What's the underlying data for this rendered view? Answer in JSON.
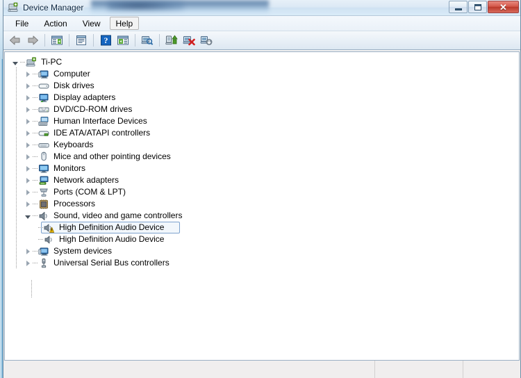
{
  "window": {
    "title": "Device Manager",
    "icon": "device-manager-icon",
    "buttons": {
      "minimize": "–",
      "maximize": "□",
      "close": "✕"
    }
  },
  "menubar": {
    "items": [
      {
        "label": "File",
        "active": false
      },
      {
        "label": "Action",
        "active": false
      },
      {
        "label": "View",
        "active": false
      },
      {
        "label": "Help",
        "active": true
      }
    ]
  },
  "toolbar": {
    "buttons": [
      {
        "name": "back-button",
        "icon": "back-arrow-icon"
      },
      {
        "name": "forward-button",
        "icon": "forward-arrow-icon"
      },
      {
        "name": "separator-1",
        "icon": "separator"
      },
      {
        "name": "show-hide-console-tree-button",
        "icon": "console-tree-icon"
      },
      {
        "name": "separator-2",
        "icon": "separator"
      },
      {
        "name": "properties-button",
        "icon": "properties-icon"
      },
      {
        "name": "separator-3",
        "icon": "separator"
      },
      {
        "name": "help-button",
        "icon": "help-question-icon"
      },
      {
        "name": "show-hide-action-pane-button",
        "icon": "action-pane-icon"
      },
      {
        "name": "separator-4",
        "icon": "separator"
      },
      {
        "name": "scan-for-hardware-changes-button",
        "icon": "scan-hardware-icon"
      },
      {
        "name": "separator-5",
        "icon": "separator"
      },
      {
        "name": "update-driver-button",
        "icon": "update-driver-icon"
      },
      {
        "name": "uninstall-device-button",
        "icon": "uninstall-device-icon"
      },
      {
        "name": "disable-device-button",
        "icon": "disable-device-icon"
      }
    ]
  },
  "tree": {
    "root": {
      "label": "Ti-PC",
      "icon": "computer-root-icon",
      "expanded": true
    },
    "items": [
      {
        "label": "Computer",
        "icon": "computer-icon",
        "expanded": false,
        "level": 1
      },
      {
        "label": "Disk drives",
        "icon": "disk-drive-icon",
        "expanded": false,
        "level": 1
      },
      {
        "label": "Display adapters",
        "icon": "display-adapter-icon",
        "expanded": false,
        "level": 1
      },
      {
        "label": "DVD/CD-ROM drives",
        "icon": "dvd-drive-icon",
        "expanded": false,
        "level": 1
      },
      {
        "label": "Human Interface Devices",
        "icon": "hid-icon",
        "expanded": false,
        "level": 1
      },
      {
        "label": "IDE ATA/ATAPI controllers",
        "icon": "ide-controller-icon",
        "expanded": false,
        "level": 1
      },
      {
        "label": "Keyboards",
        "icon": "keyboard-icon",
        "expanded": false,
        "level": 1
      },
      {
        "label": "Mice and other pointing devices",
        "icon": "mouse-icon",
        "expanded": false,
        "level": 1
      },
      {
        "label": "Monitors",
        "icon": "monitor-icon",
        "expanded": false,
        "level": 1
      },
      {
        "label": "Network adapters",
        "icon": "network-adapter-icon",
        "expanded": false,
        "level": 1
      },
      {
        "label": "Ports (COM & LPT)",
        "icon": "port-icon",
        "expanded": false,
        "level": 1
      },
      {
        "label": "Processors",
        "icon": "processor-icon",
        "expanded": false,
        "level": 1
      },
      {
        "label": "Sound, video and game controllers",
        "icon": "sound-controller-icon",
        "expanded": true,
        "level": 1
      },
      {
        "label": "High Definition Audio Device",
        "icon": "audio-device-warning-icon",
        "expanded": null,
        "level": 2,
        "selected": true,
        "warning": true
      },
      {
        "label": "High Definition Audio Device",
        "icon": "audio-device-icon",
        "expanded": null,
        "level": 2,
        "selected": false,
        "warning": false
      },
      {
        "label": "System devices",
        "icon": "system-device-icon",
        "expanded": false,
        "level": 1
      },
      {
        "label": "Universal Serial Bus controllers",
        "icon": "usb-controller-icon",
        "expanded": false,
        "level": 1
      }
    ]
  },
  "statusbar": {
    "panes": [
      "",
      "",
      ""
    ]
  },
  "colors": {
    "selection_border": "#7da2ce",
    "selection_fill": "#f2f7fc",
    "warning_yellow": "#ffcc00",
    "close_button_red": "#bb3a2c",
    "titlebar_blue": "#cfe2f2"
  }
}
